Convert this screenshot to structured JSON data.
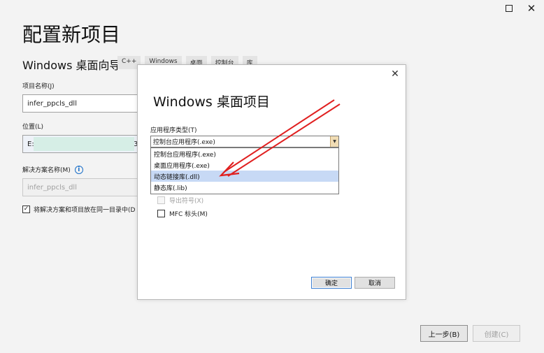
{
  "window": {
    "maximize_icon": "maximize-icon",
    "close_glyph": "✕"
  },
  "page": {
    "title": "配置新项目",
    "wizard_title": "Windows 桌面向导",
    "tags": [
      "C++",
      "Windows",
      "桌面",
      "控制台",
      "库"
    ],
    "project_name_label": "项目名称(J)",
    "project_name_value": "infer_ppcls_dll",
    "location_label": "位置(L)",
    "location_prefix": "E:\\",
    "location_suffix": "3",
    "solution_name_label": "解决方案名称(M)",
    "solution_name_value": "infer_ppcls_dll",
    "same_dir_label": "将解决方案和项目放在同一目录中(D",
    "same_dir_checked": true,
    "back_button": "上一步(B)",
    "create_button": "创建(C)"
  },
  "dialog": {
    "close_glyph": "✕",
    "title": "Windows 桌面项目",
    "app_type_label": "应用程序类型(T)",
    "app_type_selected": "控制台应用程序(.exe)",
    "app_type_options": [
      "控制台应用程序(.exe)",
      "桌面应用程序(.exe)",
      "动态链接库(.dll)",
      "静态库(.lib)"
    ],
    "highlighted_option_index": 2,
    "export_symbols_label": "导出符号(X)",
    "mfc_header_label": "MFC 标头(M)",
    "ok_button": "确定",
    "cancel_button": "取消"
  },
  "colors": {
    "annotation_arrow": "#e02020",
    "selection_highlight": "#c7d9f5",
    "info_icon": "#1a6fc9"
  }
}
